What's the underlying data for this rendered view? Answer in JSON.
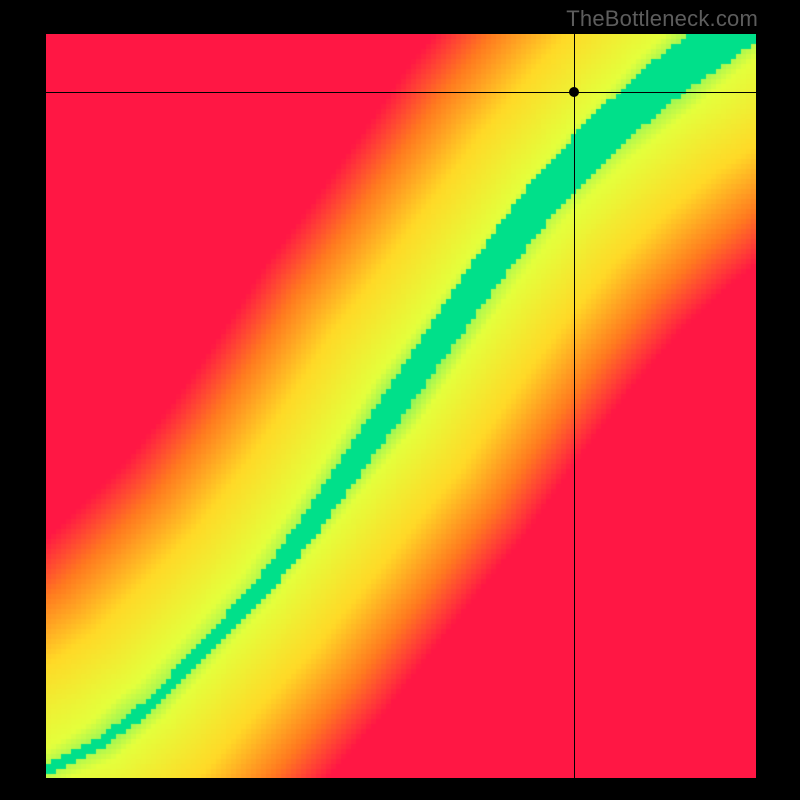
{
  "watermark": "TheBottleneck.com",
  "chart_data": {
    "type": "heatmap",
    "title": "",
    "xlabel": "",
    "ylabel": "",
    "xlim": [
      0,
      1
    ],
    "ylim": [
      0,
      1
    ],
    "crosshair": {
      "x": 0.744,
      "y": 0.922
    },
    "marker": {
      "x": 0.744,
      "y": 0.922
    },
    "green_ridge": [
      {
        "x": 0.02,
        "y": 0.02
      },
      {
        "x": 0.08,
        "y": 0.05
      },
      {
        "x": 0.15,
        "y": 0.1
      },
      {
        "x": 0.22,
        "y": 0.17
      },
      {
        "x": 0.3,
        "y": 0.25
      },
      {
        "x": 0.38,
        "y": 0.35
      },
      {
        "x": 0.46,
        "y": 0.46
      },
      {
        "x": 0.54,
        "y": 0.57
      },
      {
        "x": 0.62,
        "y": 0.68
      },
      {
        "x": 0.7,
        "y": 0.78
      },
      {
        "x": 0.78,
        "y": 0.86
      },
      {
        "x": 0.86,
        "y": 0.93
      },
      {
        "x": 0.94,
        "y": 0.985
      }
    ],
    "color_stops": [
      {
        "t": 0.0,
        "color": "#00e08a"
      },
      {
        "t": 0.25,
        "color": "#e4ff3c"
      },
      {
        "t": 0.55,
        "color": "#ffd927"
      },
      {
        "t": 0.8,
        "color": "#ff7a1f"
      },
      {
        "t": 1.0,
        "color": "#ff1744"
      }
    ],
    "ridge_width": 0.04,
    "falloff": 2.6
  }
}
